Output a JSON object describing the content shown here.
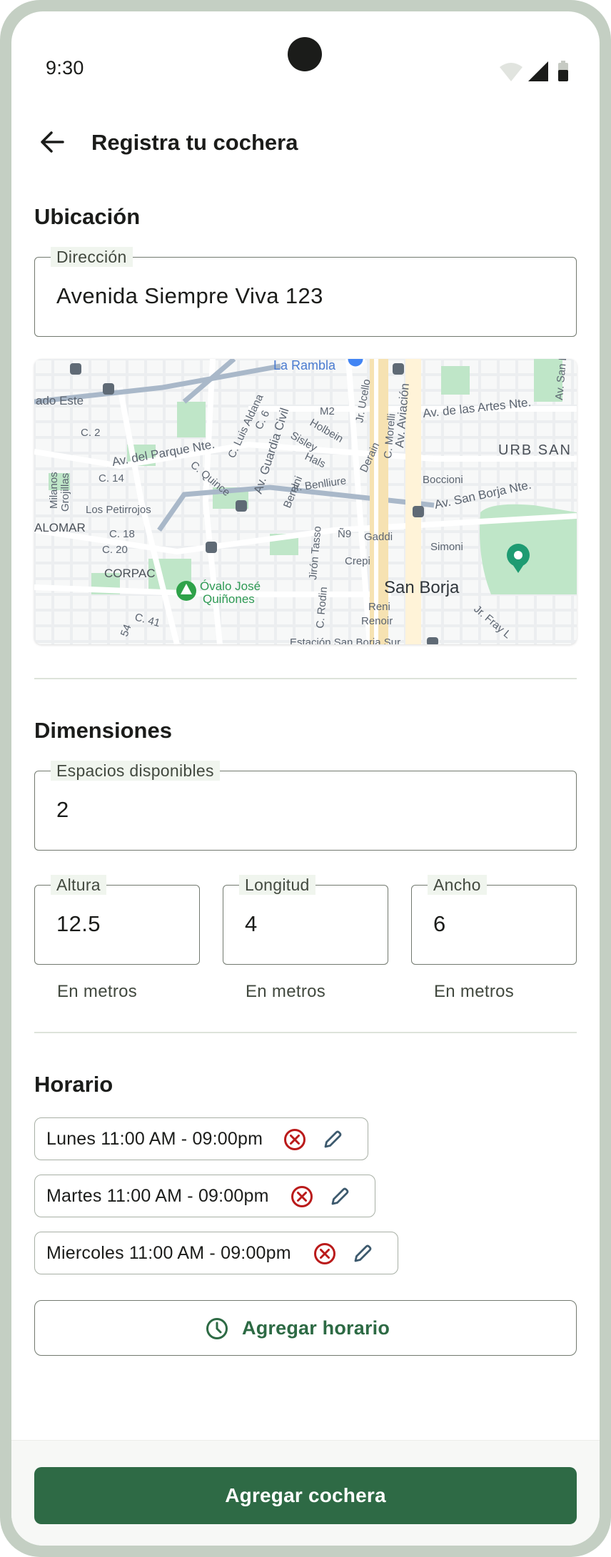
{
  "status_bar": {
    "time": "9:30"
  },
  "app_bar": {
    "title": "Registra tu cochera"
  },
  "location": {
    "section_title": "Ubicación",
    "address_label": "Dirección",
    "address_value": "Avenida Siempre Viva 123",
    "map_labels": {
      "rambla": "La Rambla",
      "este": "ado Este",
      "c2": "C. 2",
      "parque": "Av. del Parque Nte.",
      "c14": "C. 14",
      "grojillas": "Grojillas",
      "milanos": "Milanos",
      "petirrojos": "Los Petirrojos",
      "alomar": "ALOMAR",
      "c18": "C. 18",
      "c20": "C. 20",
      "corpac": "CORPAC",
      "c41": "C. 41",
      "c54": "54",
      "quince": "C. Quince",
      "luis_aldana": "C. Luis Aldana",
      "c6": "C. 6",
      "guardia": "Av. Guardia Civil",
      "bernini": "Bernini",
      "sisley": "Sisley",
      "holbein": "Holbein",
      "m2": "M2",
      "hals": "Hals",
      "derain": "Derain",
      "benlliure": "Jr. Benlliure",
      "ucello": "Jr. Ucello",
      "morelli": "C. Morelli",
      "aviacion": "Av. Aviación",
      "artes": "Av. de las Artes Nte.",
      "urb": "URB SAN",
      "san_luis": "Av. San Luis",
      "boccioni": "Boccioni",
      "san_borja_nte": "Av. San Borja Nte.",
      "n9": "Ñ9",
      "gaddi": "Gaddi",
      "simoni": "Simoni",
      "crepi": "Crepi",
      "tasso": "Jirón Tasso",
      "rodin": "C. Rodin",
      "san_borja": "San Borja",
      "reni": "Reni",
      "renoir": "Renoir",
      "fray": "Jr. Fray L",
      "ovalo1": "Óvalo José",
      "ovalo2": "Quiñones",
      "estacion": "Estación San Borja Sur"
    }
  },
  "dimensions": {
    "section_title": "Dimensiones",
    "spaces_label": "Espacios disponibles",
    "spaces_value": "2",
    "height_label": "Altura",
    "height_value": "12.5",
    "length_label": "Longitud",
    "length_value": "4",
    "width_label": "Ancho",
    "width_value": "6",
    "helper": "En metros"
  },
  "schedule": {
    "section_title": "Horario",
    "entries": [
      "Lunes 11:00 AM - 09:00pm",
      "Martes 11:00 AM - 09:00pm",
      "Miercoles 11:00 AM - 09:00pm"
    ],
    "add_label": "Agregar horario"
  },
  "primary_action": {
    "label": "Agregar cochera"
  },
  "colors": {
    "brand_green": "#2e6a45",
    "delete_red": "#ba1a1a",
    "edit_blue": "#3d5a6e",
    "frame": "#c4cfc3"
  }
}
